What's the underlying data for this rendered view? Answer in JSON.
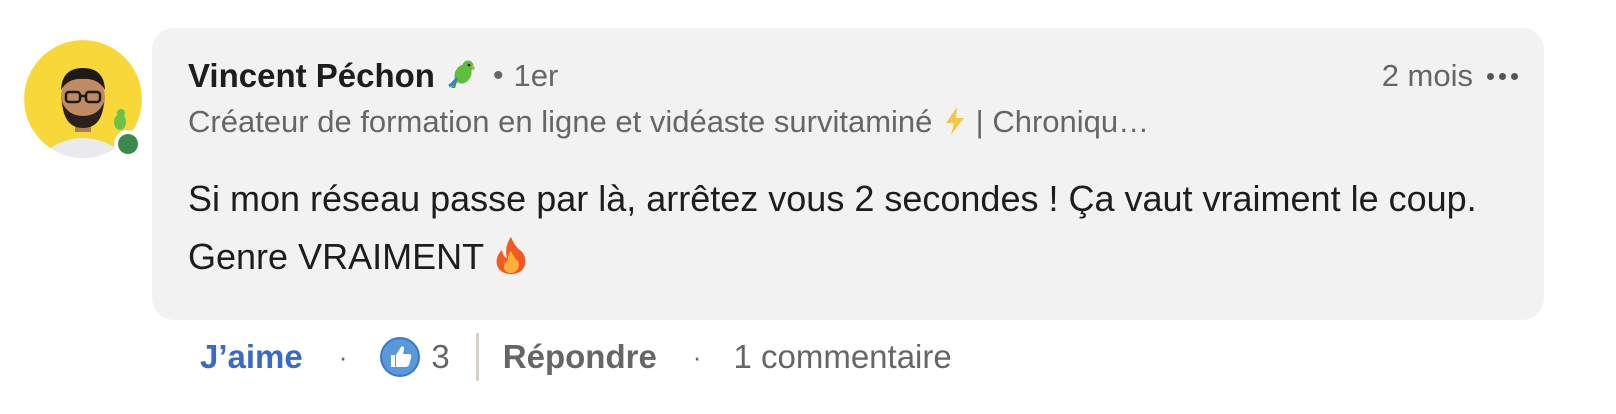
{
  "author": {
    "name": "Vincent Péchon",
    "name_icon": "parrot-icon",
    "connection_degree": "1er",
    "separator": "•",
    "online": true,
    "presence_color": "#3d8b4c",
    "headline_before_icon": "Créateur de formation en ligne et vidéaste survitaminé",
    "headline_icon": "lightning-bolt-icon",
    "headline_after_icon": "| Chroniqu…"
  },
  "comment": {
    "timestamp": "2 mois",
    "more_icon": "ellipsis-icon",
    "text": "Si mon réseau passe par là, arrêtez vous 2 secondes ! Ça vaut vraiment le coup. Genre VRAIMENT",
    "text_icon": "fire-icon"
  },
  "actions": {
    "like_label": "J’aime",
    "separator": "·",
    "reaction_icon": "like-reaction-icon",
    "reaction_count": "3",
    "reply_label": "Répondre",
    "replies_label": "1 commentaire"
  },
  "colors": {
    "bubble_background": "#f2f2f2",
    "like_blue": "#3a6bc4",
    "avatar_background": "#f7d838",
    "muted_text": "#666666"
  }
}
